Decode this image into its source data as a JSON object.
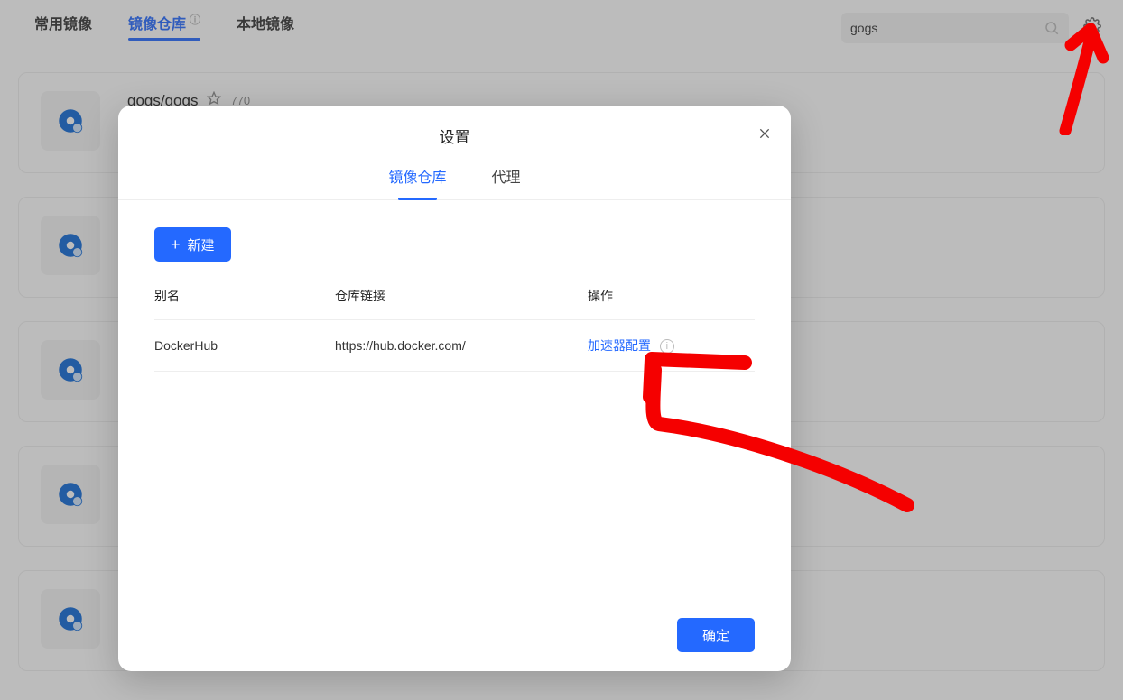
{
  "tabs": {
    "common": "常用镜像",
    "repo": "镜像仓库",
    "local": "本地镜像"
  },
  "search": {
    "value": "gogs",
    "placeholder": ""
  },
  "card0": {
    "title": "gogs/gogs",
    "stars": "770"
  },
  "modal": {
    "title": "设置",
    "tab_repo": "镜像仓库",
    "tab_proxy": "代理",
    "new_label": "新建",
    "col_alias": "别名",
    "col_link": "仓库链接",
    "col_op": "操作",
    "row0": {
      "alias": "DockerHub",
      "link": "https://hub.docker.com/",
      "op": "加速器配置"
    },
    "confirm": "确定"
  }
}
